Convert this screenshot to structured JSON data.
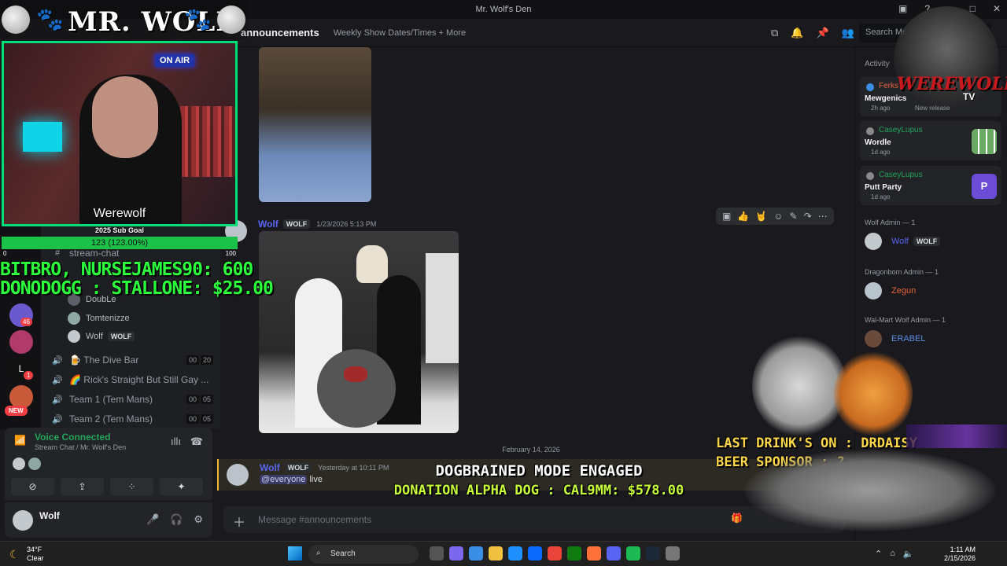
{
  "window": {
    "title": "Mr. Wolf's Den"
  },
  "header": {
    "server_name": "Mr. Wolf's Den",
    "channel": "announcements",
    "topic": "Weekly Show Dates/Times + More",
    "search_placeholder": "Search Mr. W..."
  },
  "sidebar": {
    "text_channel": "stream-chat",
    "voice_users": [
      {
        "name": "DoubLe"
      },
      {
        "name": "Tomtenizze"
      },
      {
        "name": "Wolf",
        "tag": "WOLF"
      }
    ],
    "voice_channels": [
      {
        "label": "The Dive Bar",
        "emoji": "🍺",
        "count_a": "00",
        "count_b": "20"
      },
      {
        "label": "Rick's Straight But Still Gay ...",
        "emoji": "🌈",
        "count_a": "",
        "count_b": ""
      },
      {
        "label": "Team 1 (Tem Mans)",
        "emoji": "",
        "count_a": "00",
        "count_b": "05"
      },
      {
        "label": "Team 2 (Tem Mans)",
        "emoji": "",
        "count_a": "00",
        "count_b": "05"
      }
    ],
    "badges": {
      "mentions": "46",
      "unread": "1",
      "new": "NEW"
    }
  },
  "voice_panel": {
    "status": "Voice Connected",
    "location": "Stream Chat / Mr. Wolf's Den"
  },
  "user_panel": {
    "username": "Wolf"
  },
  "messages": [
    {
      "author": "Wolf",
      "tag": "WOLF",
      "timestamp": "1/23/2026 5:13 PM"
    },
    {
      "author": "Wolf",
      "tag": "WOLF",
      "timestamp": "Yesterday at 10:11 PM",
      "mention": "@everyone",
      "text": "live"
    }
  ],
  "date_separator": "February 14, 2026",
  "composer": {
    "placeholder": "Message #announcements"
  },
  "activity": {
    "heading": "Activity",
    "cards": [
      {
        "user": "Ferks",
        "game": "Mewgenics",
        "time": "2h ago",
        "extra": "New release"
      },
      {
        "user": "CaseyLupus",
        "game": "Wordle",
        "time": "1d ago"
      },
      {
        "user": "CaseyLupus",
        "game": "Putt Party",
        "time": "1d ago"
      }
    ]
  },
  "members": [
    {
      "role": "Wolf Admin — 1",
      "name": "Wolf",
      "tag": "WOLF",
      "color": "#5865f2"
    },
    {
      "role": "Dragonborn Admin — 1",
      "name": "Zegun",
      "color": "#e8643c"
    },
    {
      "role": "Wal-Mart Wolf Admin — 1",
      "name": "ERABEL",
      "color": "#5c8de8"
    }
  ],
  "overlays": {
    "title": "MR. WOLF",
    "cam_name": "Werewolf",
    "onair": "ON AIR",
    "sub_goal_label": "2025 Sub Goal",
    "sub_goal_value": "123 (123.00%)",
    "sub_goal_min": "0",
    "sub_goal_max": "100",
    "sub_goal_progress": 1.0,
    "line1": "BITBRO, NURSEJAMES90: 600",
    "line2": "DONODOGG : STALLONE: $25.00",
    "mode": "DOGBRAINED MODE ENGAGED",
    "alpha": "DONATION ALPHA DOG : CAL9MM: $578.00",
    "drinks": "LAST DRINK'S ON : DRDAISY",
    "beer": "BEER SPONSOR : ?",
    "logo_text": "WEREWOLF",
    "logo_tv": "TV"
  },
  "taskbar": {
    "temp": "34°F",
    "weather": "Clear",
    "search": "Search",
    "time": "1:11 AM",
    "date": "2/15/2026"
  },
  "colors": {
    "accent": "#5865f2",
    "online": "#23a55a",
    "overlay_green": "#2cff3c",
    "overlay_yellow": "#ffd84a"
  }
}
